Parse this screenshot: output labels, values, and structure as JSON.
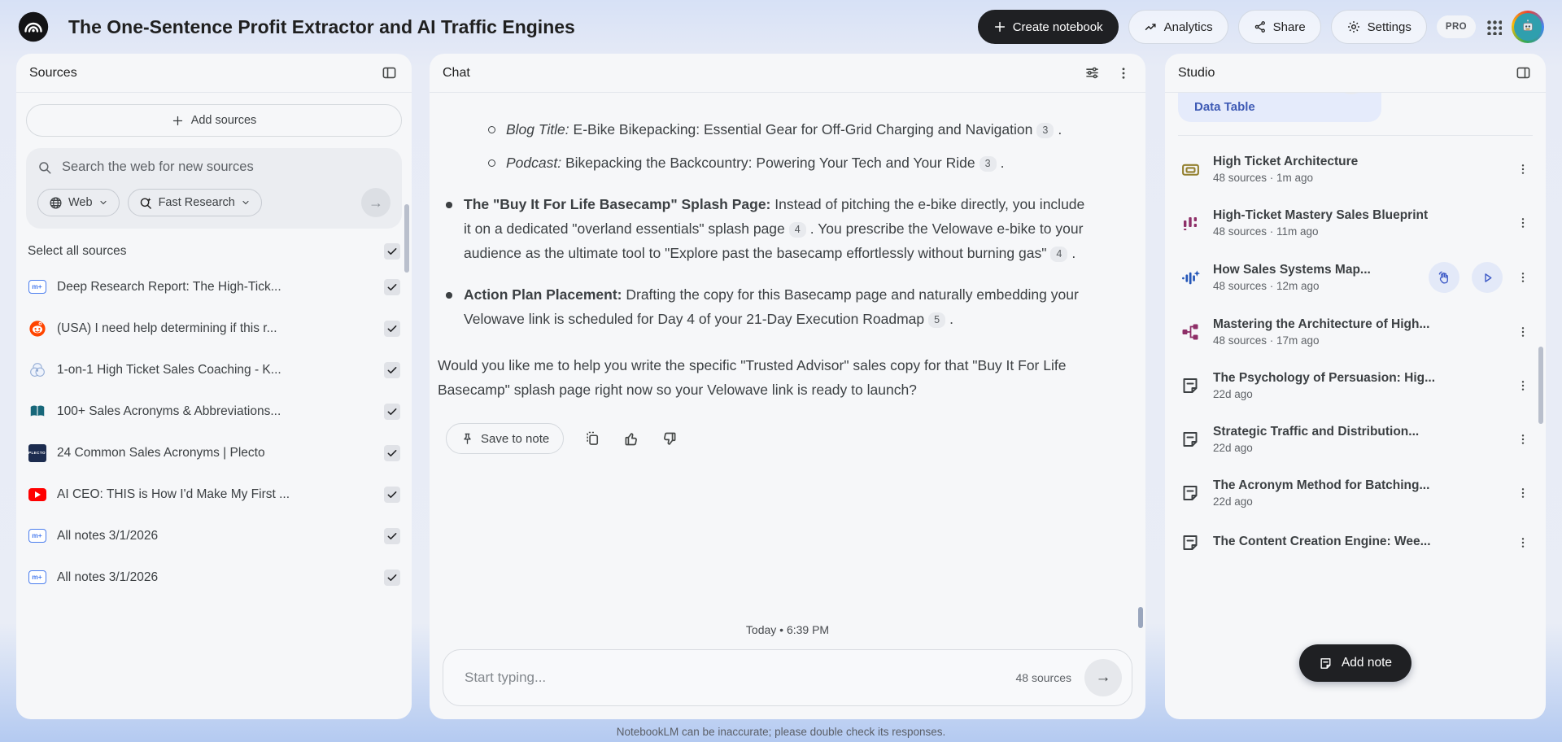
{
  "header": {
    "title": "The One-Sentence Profit Extractor and AI Traffic Engines",
    "create_notebook": "Create notebook",
    "analytics": "Analytics",
    "share": "Share",
    "settings": "Settings",
    "pro_badge": "PRO"
  },
  "sources": {
    "title": "Sources",
    "add_button": "Add sources",
    "search_placeholder": "Search the web for new sources",
    "web_filter": "Web",
    "research_mode": "Fast Research",
    "select_all": "Select all sources",
    "items": [
      {
        "icon": "notebooklm-note-icon",
        "title": "Deep Research Report: The High-Tick..."
      },
      {
        "icon": "reddit-icon",
        "title": "(USA) I need help determining if this r..."
      },
      {
        "icon": "venn-circles-icon",
        "title": "1-on-1 High Ticket Sales Coaching - K..."
      },
      {
        "icon": "book-icon",
        "title": "100+ Sales Acronyms & Abbreviations..."
      },
      {
        "icon": "plecto-icon",
        "title": "24 Common Sales Acronyms | Plecto"
      },
      {
        "icon": "youtube-icon",
        "title": "AI CEO: THIS is How I'd Make My First ..."
      },
      {
        "icon": "notebooklm-note-icon",
        "title": "All notes 3/1/2026"
      },
      {
        "icon": "notebooklm-note-icon",
        "title": "All notes 3/1/2026"
      }
    ]
  },
  "chat": {
    "title": "Chat",
    "message": {
      "sub_bullets": [
        {
          "lead": "Blog Title:",
          "text": " E-Bike Bikepacking: Essential Gear for Off-Grid Charging and Navigation",
          "cite": "3",
          "tail": "."
        },
        {
          "lead": "Podcast:",
          "text": " Bikepacking the Backcountry: Powering Your Tech and Your Ride",
          "cite": "3",
          "tail": "."
        }
      ],
      "bullets": [
        {
          "lead": "The \"Buy It For Life Basecamp\" Splash Page:",
          "text1": " Instead of pitching the e-bike directly, you include it on a dedicated \"overland essentials\" splash page",
          "cite1": "4",
          "text2": ". You prescribe the Velowave e-bike to your audience as the ultimate tool to \"Explore past the basecamp effortlessly without burning gas\"",
          "cite2": "4",
          "tail": "."
        },
        {
          "lead": "Action Plan Placement:",
          "text1": " Drafting the copy for this Basecamp page and naturally embedding your Velowave link is scheduled for Day 4 of your 21-Day Execution Roadmap",
          "cite1": "5",
          "text2": "",
          "cite2": "",
          "tail": "."
        }
      ],
      "closing": "Would you like me to help you write the specific \"Trusted Advisor\" sales copy for that \"Buy It For Life Basecamp\" splash page right now so your Velowave link is ready to launch?"
    },
    "save_to_note": "Save to note",
    "timestamp": "Today • 6:39 PM",
    "input_placeholder": "Start typing...",
    "source_count": "48 sources",
    "disclaimer": "NotebookLM can be inaccurate; please double check its responses."
  },
  "studio": {
    "title": "Studio",
    "chip_label": "Data Table",
    "items": [
      {
        "icon": "flashcards-icon",
        "title": "High Ticket Architecture",
        "meta": "48 sources · 1m ago"
      },
      {
        "icon": "bar-chart-icon",
        "title": "High-Ticket Mastery Sales Blueprint",
        "meta": "48 sources · 11m ago"
      },
      {
        "icon": "audio-waveform-icon",
        "title": "How Sales Systems Map...",
        "meta": "48 sources · 12m ago"
      },
      {
        "icon": "mind-map-icon",
        "title": "Mastering the Architecture of High...",
        "meta": "48 sources · 17m ago"
      },
      {
        "icon": "note-icon",
        "title": "The Psychology of Persuasion: Hig...",
        "meta": "22d ago"
      },
      {
        "icon": "note-icon",
        "title": "Strategic Traffic and Distribution...",
        "meta": "22d ago"
      },
      {
        "icon": "note-icon",
        "title": "The Acronym Method for Batching...",
        "meta": "22d ago"
      },
      {
        "icon": "note-icon",
        "title": "The Content Creation Engine: Wee...",
        "meta": ""
      }
    ],
    "add_note": "Add note"
  }
}
